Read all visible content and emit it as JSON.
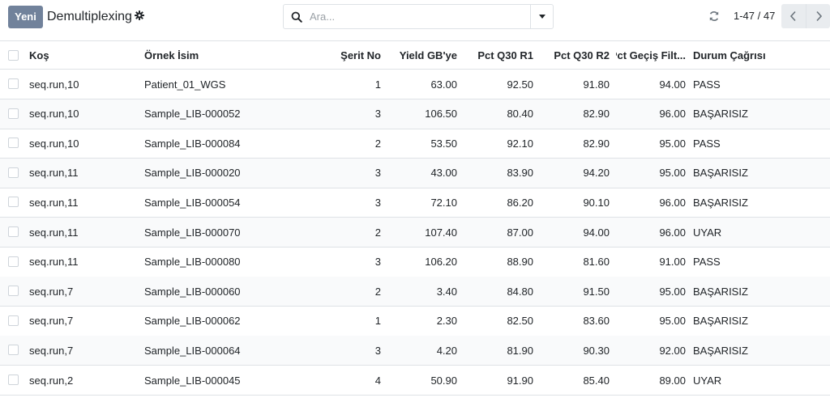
{
  "control_panel": {
    "new_button": "Yeni",
    "title": "Demultiplexing",
    "search": {
      "placeholder": "Ara...",
      "value": ""
    },
    "pager": {
      "value": "1-47 / 47"
    }
  },
  "table": {
    "columns": {
      "run": "Koş",
      "sample": "Örnek İsim",
      "lane": "Şerit No",
      "yield": "Yield GB'ye",
      "q30_r1": "Pct Q30 R1",
      "q30_r2": "Pct Q30 R2",
      "pf": "Pct Geçiş Filt...",
      "status": "Durum Çağrısı"
    },
    "rows": [
      {
        "run": "seq.run,10",
        "sample": "Patient_01_WGS",
        "lane": "1",
        "yield": "63.00",
        "q30_r1": "92.50",
        "q30_r2": "91.80",
        "pf": "94.00",
        "status": "PASS"
      },
      {
        "run": "seq.run,10",
        "sample": "Sample_LIB-000052",
        "lane": "3",
        "yield": "106.50",
        "q30_r1": "80.40",
        "q30_r2": "82.90",
        "pf": "96.00",
        "status": "BAŞARISIZ"
      },
      {
        "run": "seq.run,10",
        "sample": "Sample_LIB-000084",
        "lane": "2",
        "yield": "53.50",
        "q30_r1": "92.10",
        "q30_r2": "82.90",
        "pf": "95.00",
        "status": "PASS"
      },
      {
        "run": "seq.run,11",
        "sample": "Sample_LIB-000020",
        "lane": "3",
        "yield": "43.00",
        "q30_r1": "83.90",
        "q30_r2": "94.20",
        "pf": "95.00",
        "status": "BAŞARISIZ"
      },
      {
        "run": "seq.run,11",
        "sample": "Sample_LIB-000054",
        "lane": "3",
        "yield": "72.10",
        "q30_r1": "86.20",
        "q30_r2": "90.10",
        "pf": "96.00",
        "status": "BAŞARISIZ"
      },
      {
        "run": "seq.run,11",
        "sample": "Sample_LIB-000070",
        "lane": "2",
        "yield": "107.40",
        "q30_r1": "87.00",
        "q30_r2": "94.00",
        "pf": "96.00",
        "status": "UYAR"
      },
      {
        "run": "seq.run,11",
        "sample": "Sample_LIB-000080",
        "lane": "3",
        "yield": "106.20",
        "q30_r1": "88.90",
        "q30_r2": "81.60",
        "pf": "91.00",
        "status": "PASS"
      },
      {
        "run": "seq.run,7",
        "sample": "Sample_LIB-000060",
        "lane": "2",
        "yield": "3.40",
        "q30_r1": "84.80",
        "q30_r2": "91.50",
        "pf": "95.00",
        "status": "BAŞARISIZ"
      },
      {
        "run": "seq.run,7",
        "sample": "Sample_LIB-000062",
        "lane": "1",
        "yield": "2.30",
        "q30_r1": "82.50",
        "q30_r2": "83.60",
        "pf": "95.00",
        "status": "BAŞARISIZ"
      },
      {
        "run": "seq.run,7",
        "sample": "Sample_LIB-000064",
        "lane": "3",
        "yield": "4.20",
        "q30_r1": "81.90",
        "q30_r2": "90.30",
        "pf": "92.00",
        "status": "BAŞARISIZ"
      },
      {
        "run": "seq.run,2",
        "sample": "Sample_LIB-000045",
        "lane": "4",
        "yield": "50.90",
        "q30_r1": "91.90",
        "q30_r2": "85.40",
        "pf": "89.00",
        "status": "UYAR"
      }
    ]
  },
  "colors": {
    "primary_button": "#71829b",
    "border": "#dee2e6",
    "stripe": "#f9fafb"
  },
  "icons": [
    "gear-icon",
    "search-icon",
    "chevron-down-icon",
    "refresh-icon",
    "chevron-left-icon",
    "chevron-right-icon"
  ]
}
